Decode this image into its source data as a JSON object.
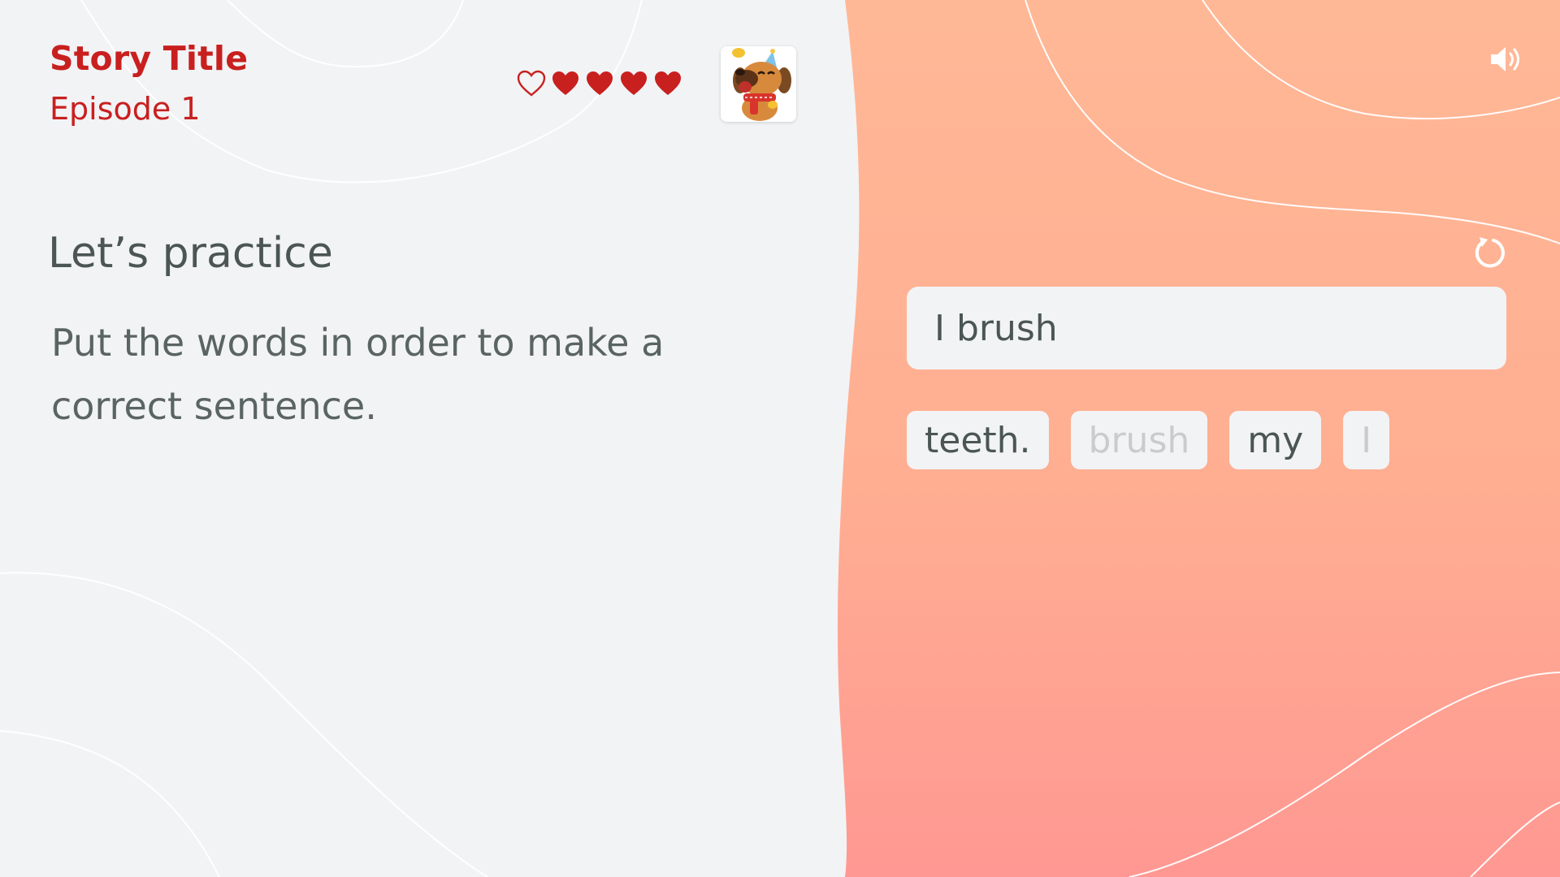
{
  "header": {
    "story_title": "Story Title",
    "episode": "Episode 1"
  },
  "lives": {
    "total": 5,
    "remaining": 4,
    "icons": [
      "heart-outline-icon",
      "heart-filled-icon",
      "heart-filled-icon",
      "heart-filled-icon",
      "heart-filled-icon"
    ]
  },
  "avatar": {
    "icon": "dog-character-avatar"
  },
  "exercise": {
    "heading": "Let’s practice",
    "instruction": "Put the words in order to make a correct sentence."
  },
  "answer": {
    "text": "I brush"
  },
  "word_chips": [
    {
      "label": "teeth.",
      "used": false
    },
    {
      "label": "brush",
      "used": true
    },
    {
      "label": "my",
      "used": false
    },
    {
      "label": "I",
      "used": true
    }
  ],
  "controls": {
    "speaker_icon": "speaker-icon",
    "reset_icon": "reset-icon"
  },
  "colors": {
    "accent_red": "#c8201f",
    "panel_light": "#f2f3f5",
    "gradient_top": "#ffb896",
    "gradient_bottom": "#ff9892",
    "text_dark": "#4b5654"
  }
}
